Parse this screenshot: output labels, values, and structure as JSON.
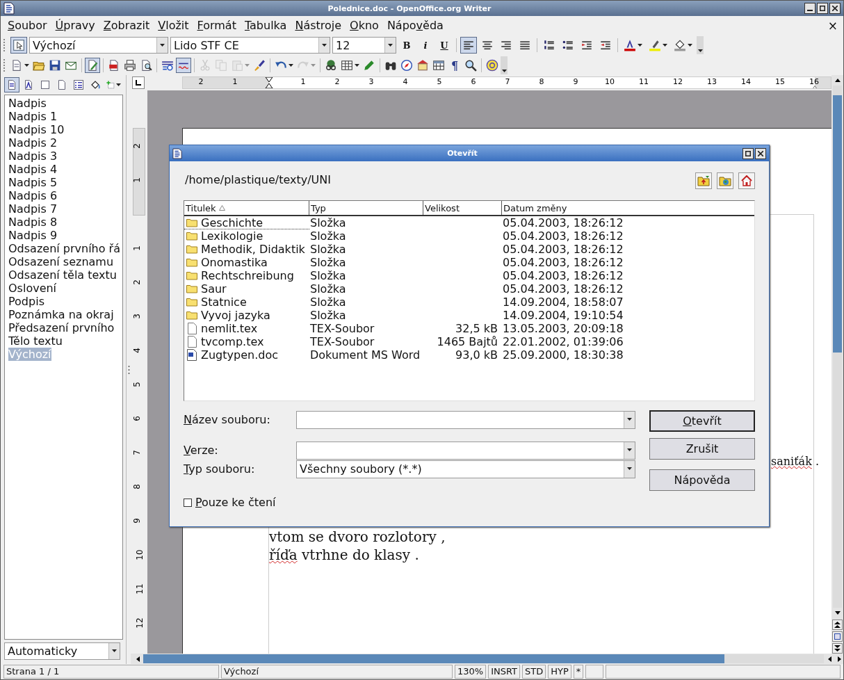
{
  "window": {
    "title": "Polednice.doc - OpenOffice.org Writer"
  },
  "menu": {
    "items": [
      {
        "key": "S",
        "rest": "oubor"
      },
      {
        "key": "Ú",
        "rest": "pravy"
      },
      {
        "key": "Z",
        "rest": "obrazit"
      },
      {
        "key": "V",
        "rest": "ložit"
      },
      {
        "key": "F",
        "rest": "ormát"
      },
      {
        "key": "T",
        "rest": "abulka"
      },
      {
        "key": "N",
        "rest": "ástroje"
      },
      {
        "key": "O",
        "rest": "kno"
      },
      {
        "lead": "Nápo",
        "key": "v",
        "rest": "ěda"
      }
    ],
    "close": "×"
  },
  "format_toolbar": {
    "items": [
      {
        "kind": "apply-style",
        "pressed": true,
        "disabled": false
      },
      {
        "kind": "style-box",
        "value": "Výchozí"
      },
      {
        "kind": "font-box",
        "value": "Lido STF CE"
      },
      {
        "kind": "size-box",
        "value": "12"
      },
      {
        "kind": "bold",
        "label": "B",
        "pressed": false,
        "disabled": false
      },
      {
        "kind": "italic",
        "label": "i",
        "pressed": false,
        "disabled": false
      },
      {
        "kind": "underline",
        "label": "U",
        "pressed": false,
        "disabled": false
      },
      {
        "kind": "separator"
      },
      {
        "kind": "align-left",
        "pressed": true,
        "disabled": false
      },
      {
        "kind": "align-center",
        "pressed": false,
        "disabled": false
      },
      {
        "kind": "align-right",
        "pressed": false,
        "disabled": false
      },
      {
        "kind": "justify",
        "pressed": false,
        "disabled": false
      },
      {
        "kind": "separator"
      },
      {
        "kind": "numbering",
        "pressed": false,
        "disabled": false
      },
      {
        "kind": "bullets",
        "pressed": false,
        "disabled": false
      },
      {
        "kind": "indent-less",
        "pressed": false,
        "disabled": false
      },
      {
        "kind": "indent-more",
        "pressed": false,
        "disabled": false
      },
      {
        "kind": "separator"
      },
      {
        "kind": "font-color",
        "pressed": false,
        "dropdown": true,
        "disabled": false
      },
      {
        "kind": "highlight",
        "pressed": false,
        "dropdown": true,
        "disabled": false
      },
      {
        "kind": "background",
        "pressed": false,
        "dropdown": true,
        "disabled": false
      },
      {
        "kind": "more"
      }
    ]
  },
  "standard_toolbar": {
    "items": [
      {
        "kind": "new",
        "pressed": false,
        "dropdown": true,
        "disabled": false
      },
      {
        "kind": "open",
        "pressed": false,
        "disabled": false
      },
      {
        "kind": "save",
        "pressed": false,
        "disabled": false
      },
      {
        "kind": "email",
        "pressed": false,
        "disabled": false
      },
      {
        "kind": "separator"
      },
      {
        "kind": "edit",
        "pressed": true,
        "disabled": false
      },
      {
        "kind": "separator"
      },
      {
        "kind": "pdf",
        "pressed": false,
        "disabled": false
      },
      {
        "kind": "print",
        "pressed": false,
        "disabled": false
      },
      {
        "kind": "preview",
        "pressed": false,
        "disabled": false
      },
      {
        "kind": "separator"
      },
      {
        "kind": "spell",
        "disabled": false
      },
      {
        "kind": "autospell",
        "pressed": true,
        "disabled": false
      },
      {
        "kind": "separator"
      },
      {
        "kind": "cut",
        "pressed": false,
        "disabled": true
      },
      {
        "kind": "copy",
        "pressed": false,
        "disabled": true
      },
      {
        "kind": "paste",
        "pressed": false,
        "dropdown": true,
        "disabled": true
      },
      {
        "kind": "brush",
        "pressed": false,
        "disabled": false
      },
      {
        "kind": "separator"
      },
      {
        "kind": "undo",
        "pressed": false,
        "dropdown": true,
        "disabled": false
      },
      {
        "kind": "redo",
        "pressed": false,
        "dropdown": true,
        "disabled": true
      },
      {
        "kind": "separator"
      },
      {
        "kind": "hyperlink",
        "pressed": false,
        "disabled": false
      },
      {
        "kind": "table",
        "pressed": false,
        "dropdown": true,
        "disabled": false
      },
      {
        "kind": "draw",
        "pressed": false,
        "disabled": false
      },
      {
        "kind": "separator"
      },
      {
        "kind": "find",
        "pressed": false,
        "disabled": false
      },
      {
        "kind": "navigator",
        "pressed": false,
        "disabled": false
      },
      {
        "kind": "gallery",
        "pressed": false,
        "disabled": false
      },
      {
        "kind": "datasource",
        "pressed": false,
        "disabled": false
      },
      {
        "kind": "marks",
        "label": "¶",
        "pressed": false,
        "disabled": false
      },
      {
        "kind": "zoom",
        "pressed": false,
        "disabled": false
      },
      {
        "kind": "separator"
      },
      {
        "kind": "help",
        "pressed": false,
        "disabled": false
      },
      {
        "kind": "more"
      }
    ]
  },
  "stylist": {
    "toolbar": [
      {
        "kind": "paragraph-styles",
        "pressed": true
      },
      {
        "kind": "character-styles",
        "pressed": false
      },
      {
        "kind": "frame-styles",
        "pressed": false
      },
      {
        "kind": "page-styles",
        "pressed": false
      },
      {
        "kind": "list-styles",
        "pressed": false
      },
      {
        "kind": "fill-format",
        "pressed": false
      },
      {
        "kind": "new-style",
        "pressed": false,
        "dropdown": true
      }
    ],
    "styles": [
      {
        "label": "Nadpis",
        "selected": false
      },
      {
        "label": "Nadpis 1",
        "selected": false
      },
      {
        "label": "Nadpis 10",
        "selected": false
      },
      {
        "label": "Nadpis 2",
        "selected": false
      },
      {
        "label": "Nadpis 3",
        "selected": false
      },
      {
        "label": "Nadpis 4",
        "selected": false
      },
      {
        "label": "Nadpis 5",
        "selected": false
      },
      {
        "label": "Nadpis 6",
        "selected": false
      },
      {
        "label": "Nadpis 7",
        "selected": false
      },
      {
        "label": "Nadpis 8",
        "selected": false
      },
      {
        "label": "Nadpis 9",
        "selected": false
      },
      {
        "label": "Odsazení prvního řá",
        "selected": false
      },
      {
        "label": "Odsazení seznamu",
        "selected": false
      },
      {
        "label": "Odsazení těla textu",
        "selected": false
      },
      {
        "label": "Oslovení",
        "selected": false
      },
      {
        "label": "Podpis",
        "selected": false
      },
      {
        "label": "Poznámka na okraj",
        "selected": false
      },
      {
        "label": "Předsazení prvního",
        "selected": false
      },
      {
        "label": "Tělo textu",
        "selected": false
      },
      {
        "label": "Výchozí",
        "selected": true
      }
    ],
    "filter": "Automaticky"
  },
  "ruler": {
    "marks_before": [
      "2",
      "1"
    ],
    "marks_after": [
      "1",
      "2",
      "3",
      "4",
      "5",
      "6",
      "7",
      "8",
      "9",
      "10",
      "11",
      "12",
      "13",
      "14",
      "15",
      "16"
    ]
  },
  "vertical_ruler": {
    "marks_before": [
      "2",
      "1"
    ],
    "marks_after": [
      "1",
      "2",
      "3",
      "4",
      "5",
      "6",
      "7",
      "8",
      "9",
      "10",
      "11",
      "12"
    ]
  },
  "document": {
    "lines": [
      {
        "segments": [
          {
            "text": "saniťák",
            "misspelled": true
          },
          {
            "text": " .",
            "misspelled": false
          }
        ]
      },
      {
        "segments": [
          {
            "text": "vtom se dvoro rozlotory ,",
            "misspelled": false
          }
        ]
      },
      {
        "segments": [
          {
            "text": "říďa",
            "misspelled": true
          },
          {
            "text": " vtrhne do klasy .",
            "misspelled": false
          }
        ]
      }
    ]
  },
  "dialog": {
    "title": "Otevřít",
    "path": "/home/plastique/texty/UNI",
    "columns": [
      {
        "label": "Titulek",
        "sorted": true
      },
      {
        "label": "Typ",
        "sorted": false
      },
      {
        "label": "Velikost",
        "sorted": false
      },
      {
        "label": "Datum změny",
        "sorted": false
      }
    ],
    "rows": [
      {
        "kind": "folder",
        "name": "Geschichte",
        "type": "Složka",
        "date": "05.04.2003, 18:26:12",
        "focused": true
      },
      {
        "kind": "folder",
        "name": "Lexikologie",
        "type": "Složka",
        "date": "05.04.2003, 18:26:12",
        "focused": false
      },
      {
        "kind": "folder",
        "name": "Methodik, Didaktik",
        "type": "Složka",
        "date": "05.04.2003, 18:26:12",
        "focused": false
      },
      {
        "kind": "folder",
        "name": "Onomastika",
        "type": "Složka",
        "date": "05.04.2003, 18:26:12",
        "focused": false
      },
      {
        "kind": "folder",
        "name": "Rechtschreibung",
        "type": "Složka",
        "date": "05.04.2003, 18:26:12",
        "focused": false
      },
      {
        "kind": "folder",
        "name": "Saur",
        "type": "Složka",
        "date": "05.04.2003, 18:26:12",
        "focused": false
      },
      {
        "kind": "folder",
        "name": "Statnice",
        "type": "Složka",
        "date": "14.09.2004, 18:58:07",
        "focused": false
      },
      {
        "kind": "folder",
        "name": "Vyvoj jazyka",
        "type": "Složka",
        "date": "14.09.2004, 19:10:54",
        "focused": false
      },
      {
        "kind": "file",
        "name": "nemlit.tex",
        "type": "TEX-Soubor",
        "size": "32,5 kB",
        "date": "13.05.2003, 20:09:18",
        "focused": false
      },
      {
        "kind": "file",
        "name": "tvcomp.tex",
        "type": "TEX-Soubor",
        "size": "1465 Bajtů",
        "date": "22.01.2002, 01:39:06",
        "focused": false
      },
      {
        "kind": "word",
        "name": "Zugtypen.doc",
        "type": "Dokument MS Word",
        "size": "93,0 kB",
        "date": "25.09.2000, 18:30:38",
        "focused": false
      }
    ],
    "fields": [
      {
        "key": "N",
        "rest": "ázev souboru:"
      },
      {
        "key": "V",
        "rest": "erze:"
      },
      {
        "key": "T",
        "rest": "yp souboru:",
        "value": "Všechny soubory (*.*)"
      }
    ],
    "buttons": [
      {
        "key": "O",
        "rest": "tevřít",
        "default": true
      },
      {
        "rest": "Zrušit",
        "default": false
      },
      {
        "rest": "Nápověda",
        "default": false
      }
    ],
    "read_only": {
      "key": "P",
      "rest": "ouze ke čtení",
      "checked": false
    }
  },
  "status_bar": {
    "items": [
      "Strana 1 / 1",
      "Výchozí",
      "130%",
      "INSRT",
      "STD",
      "HYP",
      "*"
    ]
  }
}
